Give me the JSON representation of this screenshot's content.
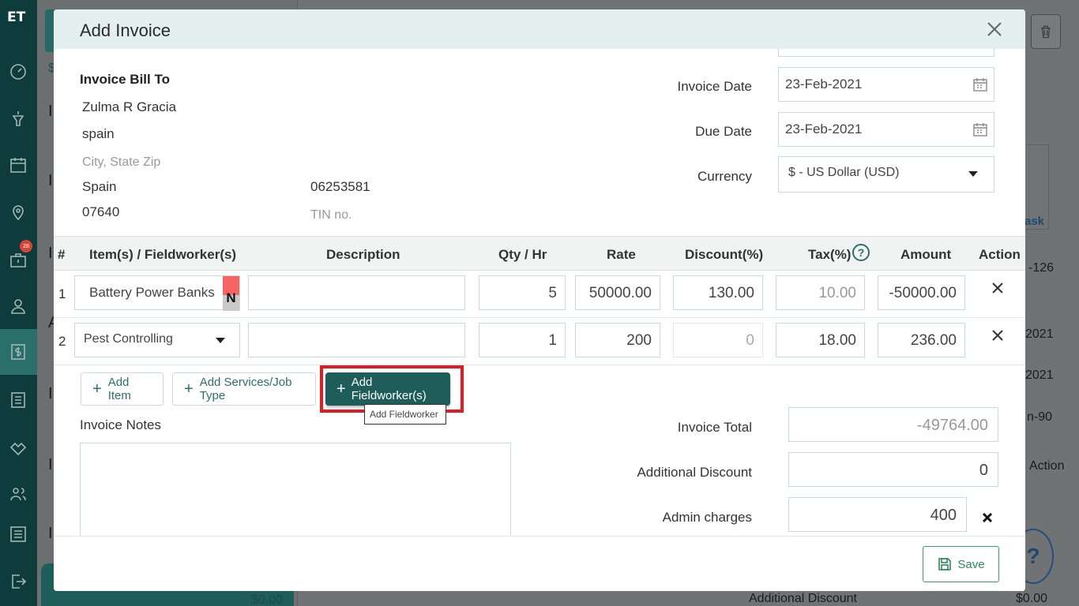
{
  "app_logo": "ET",
  "sidebar": {
    "badge": "28",
    "icons": [
      "dashboard-icon",
      "funnel-icon",
      "calendar-icon",
      "map-pin-icon",
      "briefcase-icon",
      "person-icon",
      "dollar-icon",
      "list-icon",
      "handshake-icon",
      "users-icon",
      "sliders-icon",
      "logout-icon"
    ]
  },
  "background": {
    "right_texts": [
      "-126",
      "2021",
      "2021",
      "n-90",
      "Action"
    ],
    "bottom_left": "$0.00",
    "bottom_label": "Additional Discount",
    "bottom_value": "$0.00",
    "logo_text": "ask",
    "list_amount_prefix": "$"
  },
  "modal": {
    "title": "Add Invoice",
    "bill_to": {
      "heading": "Invoice Bill To",
      "name": "Zulma R Gracia",
      "address": "spain",
      "city_placeholder": "City, State Zip",
      "country": "Spain",
      "zip": "07640",
      "phone": "06253581",
      "tin_placeholder": "TIN no."
    },
    "invoice_date": {
      "label": "Invoice Date",
      "value": "23-Feb-2021"
    },
    "due_date": {
      "label": "Due Date",
      "value": "23-Feb-2021"
    },
    "currency": {
      "label": "Currency",
      "value": "$ - US Dollar (USD)"
    },
    "table": {
      "headers": [
        "#",
        "Item(s) / Fieldworker(s)",
        "Description",
        "Qty / Hr",
        "Rate",
        "Discount(%)",
        "Tax(%)",
        "Amount",
        "Action"
      ],
      "rows": [
        {
          "num": "1",
          "item": "Battery Power Banks",
          "flag": "N",
          "description": "",
          "qty": "5",
          "rate": "50000.00",
          "discount": "130.00",
          "tax": "10.00",
          "amount": "-50000.00"
        },
        {
          "num": "2",
          "item": "Pest Controlling",
          "description": "",
          "qty": "1",
          "rate": "200",
          "discount": "0",
          "tax": "18.00",
          "amount": "236.00"
        }
      ]
    },
    "buttons": {
      "add_item": "Add Item",
      "add_services": "Add Services/Job Type",
      "add_fieldworker": "Add Fieldworker(s)",
      "tooltip": "Add Fieldworker"
    },
    "notes": {
      "label": "Invoice Notes",
      "value": ""
    },
    "summary": {
      "invoice_total": {
        "label": "Invoice Total",
        "value": "-49764.00"
      },
      "additional_discount": {
        "label": "Additional Discount",
        "value": "0"
      },
      "admin_charges": {
        "label": "Admin charges",
        "value": "400"
      }
    },
    "save_label": "Save"
  },
  "colors": {
    "sidebar_bg": "#0e3b3c",
    "accent": "#1f5d5a",
    "highlight": "#e01b24",
    "save_green": "#2e8b57"
  }
}
